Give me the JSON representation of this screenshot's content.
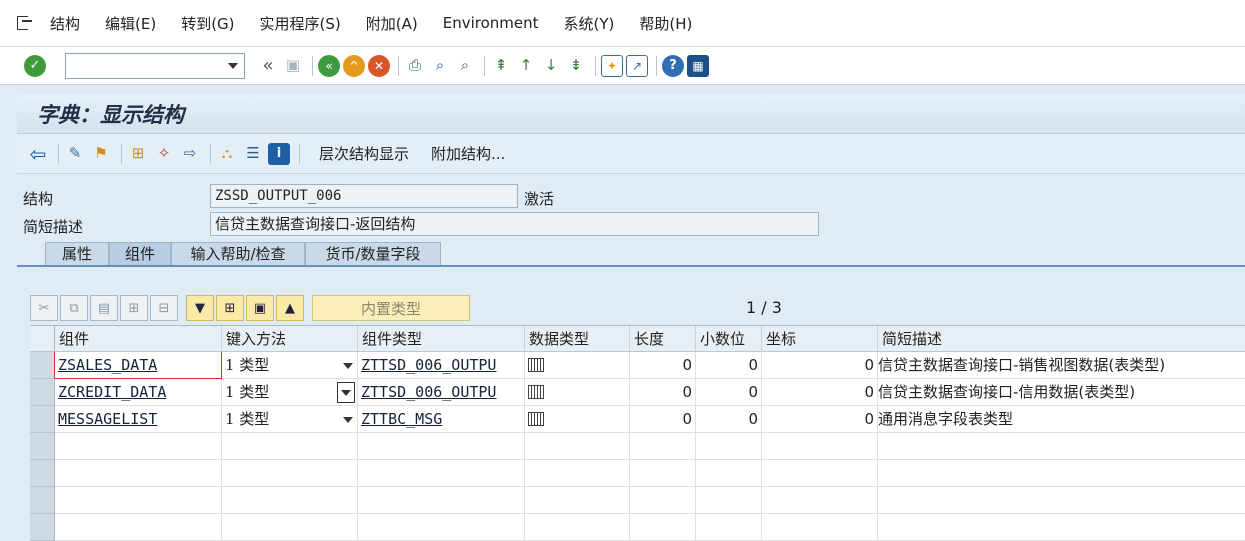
{
  "menu": {
    "items": [
      "结构",
      "编辑(E)",
      "转到(G)",
      "实用程序(S)",
      "附加(A)",
      "Environment",
      "系统(Y)",
      "帮助(H)"
    ]
  },
  "toolbar": {
    "command_value": "",
    "double_arrow": "«"
  },
  "title": "字典：显示结构",
  "app_toolbar": {
    "hierarchy_label": "层次结构显示",
    "append_label": "附加结构..."
  },
  "header": {
    "structure_label": "结构",
    "structure_value": "ZSSD_OUTPUT_006",
    "status": "激活",
    "short_desc_label": "简短描述",
    "short_desc_value": "信贷主数据查询接口-返回结构"
  },
  "tabs": [
    {
      "label": "属性"
    },
    {
      "label": "组件"
    },
    {
      "label": "输入帮助/检查"
    },
    {
      "label": "货币/数量字段"
    }
  ],
  "table_toolbar": {
    "builtin_type_label": "内置类型",
    "pager": "1  /  3"
  },
  "columns": [
    "组件",
    "键入方法",
    "组件类型",
    "数据类型",
    "长度",
    "小数位",
    "坐标",
    "简短描述"
  ],
  "rows": [
    {
      "component": "ZSALES_DATA",
      "typing": "1 类型",
      "comp_type": "ZTTSD_006_OUTPU",
      "length": "0",
      "decimals": "0",
      "coord": "0",
      "desc": "信贷主数据查询接口-销售视图数据(表类型)"
    },
    {
      "component": "ZCREDIT_DATA",
      "typing": "1 类型",
      "comp_type": "ZTTSD_006_OUTPU",
      "length": "0",
      "decimals": "0",
      "coord": "0",
      "desc": "信贷主数据查询接口-信用数据(表类型)"
    },
    {
      "component": "MESSAGELIST",
      "typing": "1 类型",
      "comp_type": "ZTTBC_MSG",
      "length": "0",
      "decimals": "0",
      "coord": "0",
      "desc": "通用消息字段表类型"
    }
  ]
}
